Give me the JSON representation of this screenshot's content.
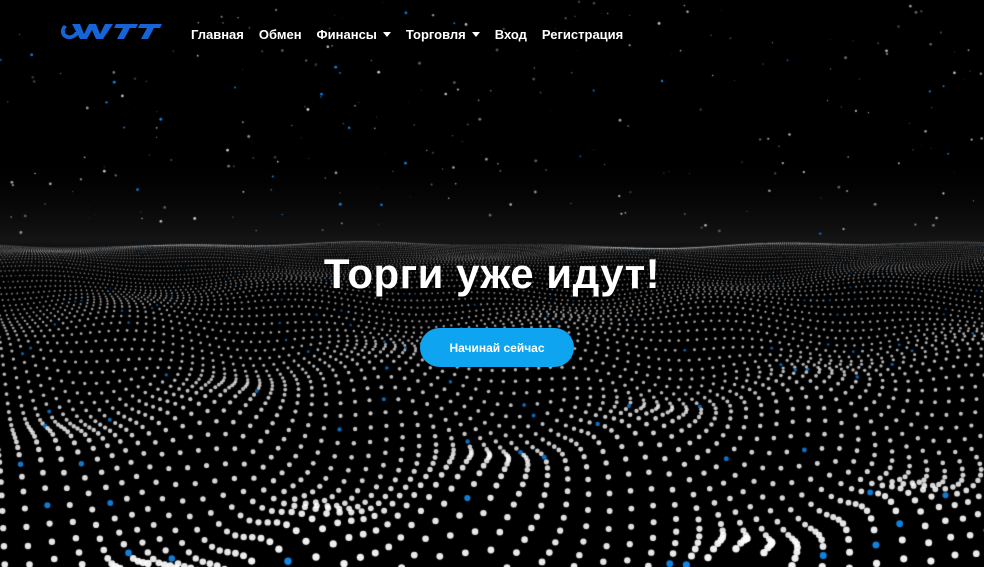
{
  "brand": {
    "logo_text": "WTT",
    "logo_color": "#1565d8"
  },
  "nav": {
    "items": [
      {
        "label": "Главная",
        "dropdown": false
      },
      {
        "label": "Обмен",
        "dropdown": false
      },
      {
        "label": "Финансы",
        "dropdown": true
      },
      {
        "label": "Торговля",
        "dropdown": true
      },
      {
        "label": "Вход",
        "dropdown": false
      },
      {
        "label": "Регистрация",
        "dropdown": false
      }
    ]
  },
  "hero": {
    "title": "Торги уже идут!",
    "cta_label": "Начинай сейчас",
    "cta_color": "#0ea4f0",
    "background": "particle-wave"
  }
}
